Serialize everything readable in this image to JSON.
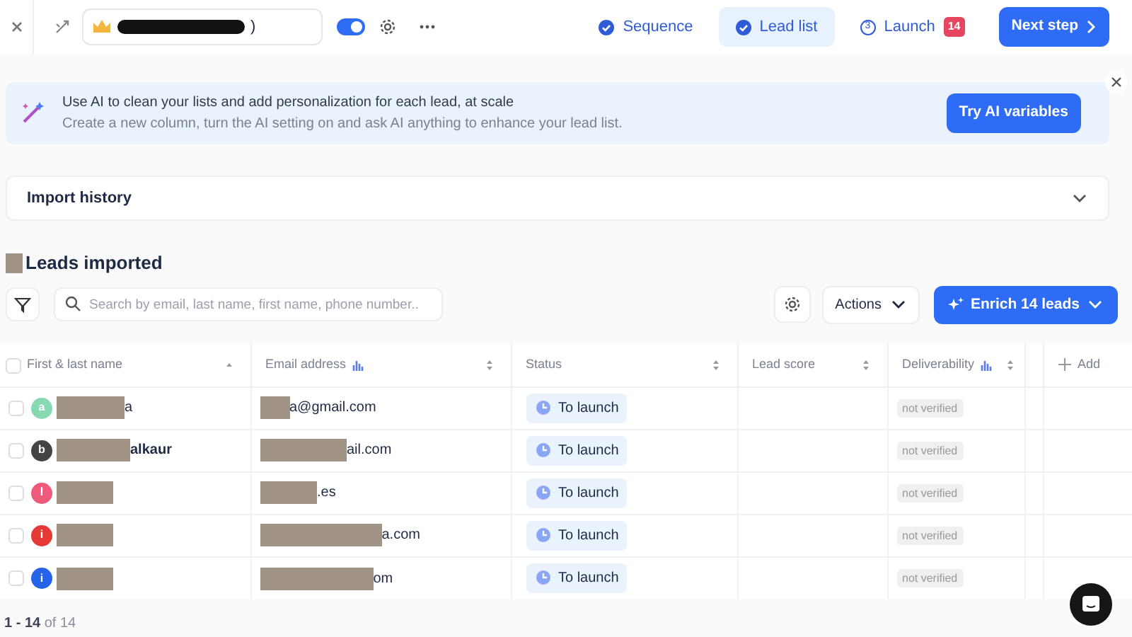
{
  "topbar": {
    "campaign_title": ")",
    "toggle_on": true
  },
  "tabs": [
    {
      "label": "Sequence",
      "kind": "done",
      "selected": false
    },
    {
      "label": "Lead list",
      "kind": "done",
      "selected": true
    },
    {
      "label": "Launch",
      "kind": "step",
      "step": "3",
      "badge": "14",
      "selected": false
    }
  ],
  "next_button": "Next step",
  "banner": {
    "title": "Use AI to clean your lists and add personalization for each lead, at scale",
    "text": "Create a new column, turn the AI setting on and ask AI anything to enhance your lead list.",
    "button": "Try AI variables"
  },
  "import_history": {
    "label": "Import history",
    "expanded": false
  },
  "heading": "Leads imported",
  "search": {
    "placeholder": "Search by email, last name, first name, phone number.."
  },
  "actions_button": "Actions",
  "enrich_button": "Enrich 14 leads",
  "table": {
    "select_all_checked": false,
    "columns": [
      {
        "label": "First & last name",
        "sorted": true,
        "ai": false
      },
      {
        "label": "Email address",
        "sorted": false,
        "ai": true
      },
      {
        "label": "Status",
        "sorted": false,
        "ai": false
      },
      {
        "label": "Lead score",
        "sorted": false,
        "ai": false
      },
      {
        "label": "Deliverability",
        "sorted": false,
        "ai": true
      }
    ],
    "add_column": "Add",
    "rows": [
      {
        "initial": "a",
        "color": "#86d9b0",
        "name": "a",
        "email": "a@gmail.com",
        "status": "To launch",
        "deliverability": "not verified",
        "checked": false
      },
      {
        "initial": "b",
        "color": "#444444",
        "name": "alkaur",
        "email": "ail.com",
        "status": "To launch",
        "deliverability": "not verified",
        "checked": false
      },
      {
        "initial": "l",
        "color": "#ee5a7a",
        "email": ".es",
        "status": "To launch",
        "deliverability": "not verified",
        "checked": false
      },
      {
        "initial": "i",
        "color": "#e53935",
        "email": "a.com",
        "status": "To launch",
        "deliverability": "not verified",
        "checked": false
      },
      {
        "initial": "i",
        "color": "#2563eb",
        "email": "om",
        "status": "To launch",
        "deliverability": "not verified",
        "checked": false
      }
    ]
  },
  "pagination": "**1 - 14** of 14"
}
